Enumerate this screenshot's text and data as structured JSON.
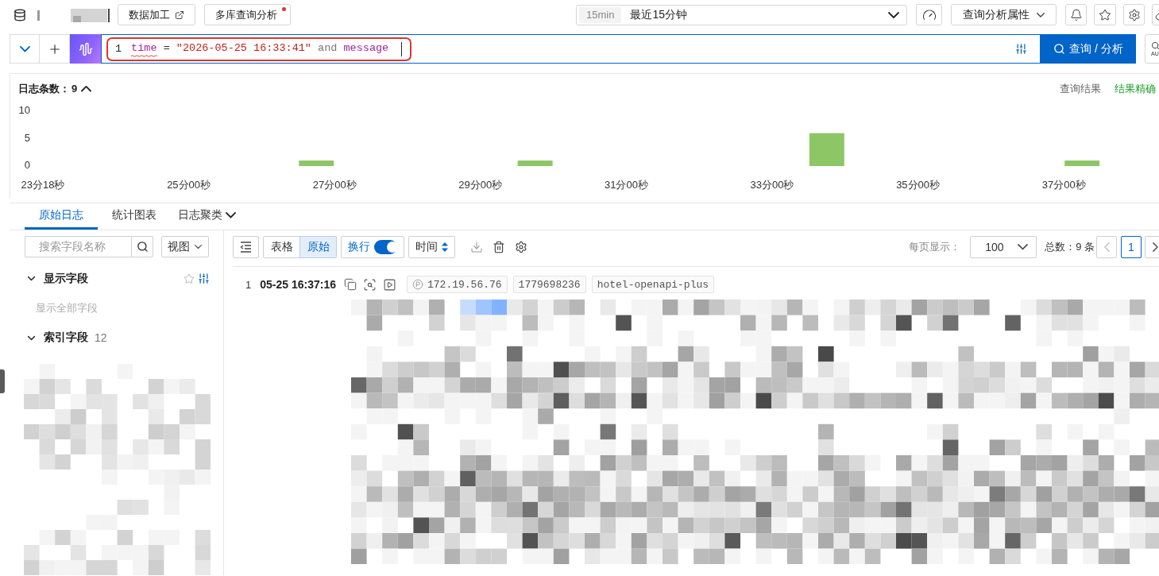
{
  "header": {
    "buttons": [
      {
        "label": "数据加工",
        "kind": "external"
      },
      {
        "label": "多库查询分析",
        "kind": "notify"
      }
    ],
    "time_range": {
      "tag": "15min",
      "label": "最近15分钟"
    },
    "properties_menu": "查询分析属性"
  },
  "query": {
    "line_number": "1",
    "highlighted": true,
    "tokens": [
      {
        "kind": "field",
        "text": "time",
        "error": true
      },
      {
        "kind": "operator",
        "text": "=",
        "error": false
      },
      {
        "kind": "string",
        "text": "\"2026-05-25 16:33:41\"",
        "error": false
      },
      {
        "kind": "keyword",
        "text": "and",
        "error": false
      },
      {
        "kind": "field",
        "text": "message",
        "error": false
      }
    ],
    "submit": "查询 / 分析",
    "side_button": "AU"
  },
  "histogram": {
    "title": "日志条数：",
    "count": "9",
    "expanded": true,
    "mode": "查询结果",
    "accuracy": "结果精确",
    "chart_data": {
      "type": "bar",
      "categories": [
        "23分18秒",
        null,
        null,
        null,
        "25分00秒",
        null,
        null,
        null,
        "27分00秒",
        null,
        null,
        null,
        "29分00秒",
        null,
        null,
        null,
        "31分00秒",
        null,
        null,
        null,
        "33分00秒",
        null,
        null,
        null,
        "35分00秒",
        null,
        null,
        null,
        "37分00秒",
        null
      ],
      "values": [
        0,
        0,
        0,
        0,
        0,
        0,
        0,
        1,
        0,
        0,
        0,
        0,
        0,
        1,
        0,
        0,
        0,
        0,
        0,
        0,
        0,
        6,
        0,
        0,
        0,
        0,
        0,
        0,
        1,
        0
      ],
      "ylim": [
        0,
        10
      ],
      "yticks": [
        0,
        5,
        10
      ]
    }
  },
  "tabs": [
    {
      "label": "原始日志",
      "selected": true,
      "kind": "plain"
    },
    {
      "label": "统计图表",
      "selected": false,
      "kind": "plain"
    },
    {
      "label": "日志聚类",
      "selected": false,
      "kind": "dropdown"
    }
  ],
  "field_panel": {
    "search_placeholder": "搜索字段名称",
    "view_select": "视图",
    "sections": [
      {
        "kind": "display",
        "title": "显示字段",
        "expanded": true,
        "hint": "显示全部字段"
      },
      {
        "kind": "index",
        "title": "索引字段",
        "expanded": true,
        "count": "12"
      }
    ]
  },
  "log_toolbar": {
    "view_modes": [
      {
        "label": "表格",
        "selected": false
      },
      {
        "label": "原始",
        "selected": true
      }
    ],
    "wrap": {
      "label": "换行",
      "on": true
    },
    "sort": "时间",
    "page_size_label": "每页显示：",
    "page_size": "100",
    "total": "总数：9 条",
    "prev_disabled": true,
    "next_disabled": false,
    "pages": [
      {
        "label": "1",
        "selected": true
      }
    ]
  },
  "logs": [
    {
      "index": "1",
      "time": "05-25 16:37:16",
      "tags": [
        {
          "kind": "ip",
          "text": "172.19.56.76"
        },
        {
          "kind": "plain",
          "text": "1779698236"
        },
        {
          "kind": "plain",
          "text": "hotel-openapi-plus"
        }
      ]
    }
  ]
}
